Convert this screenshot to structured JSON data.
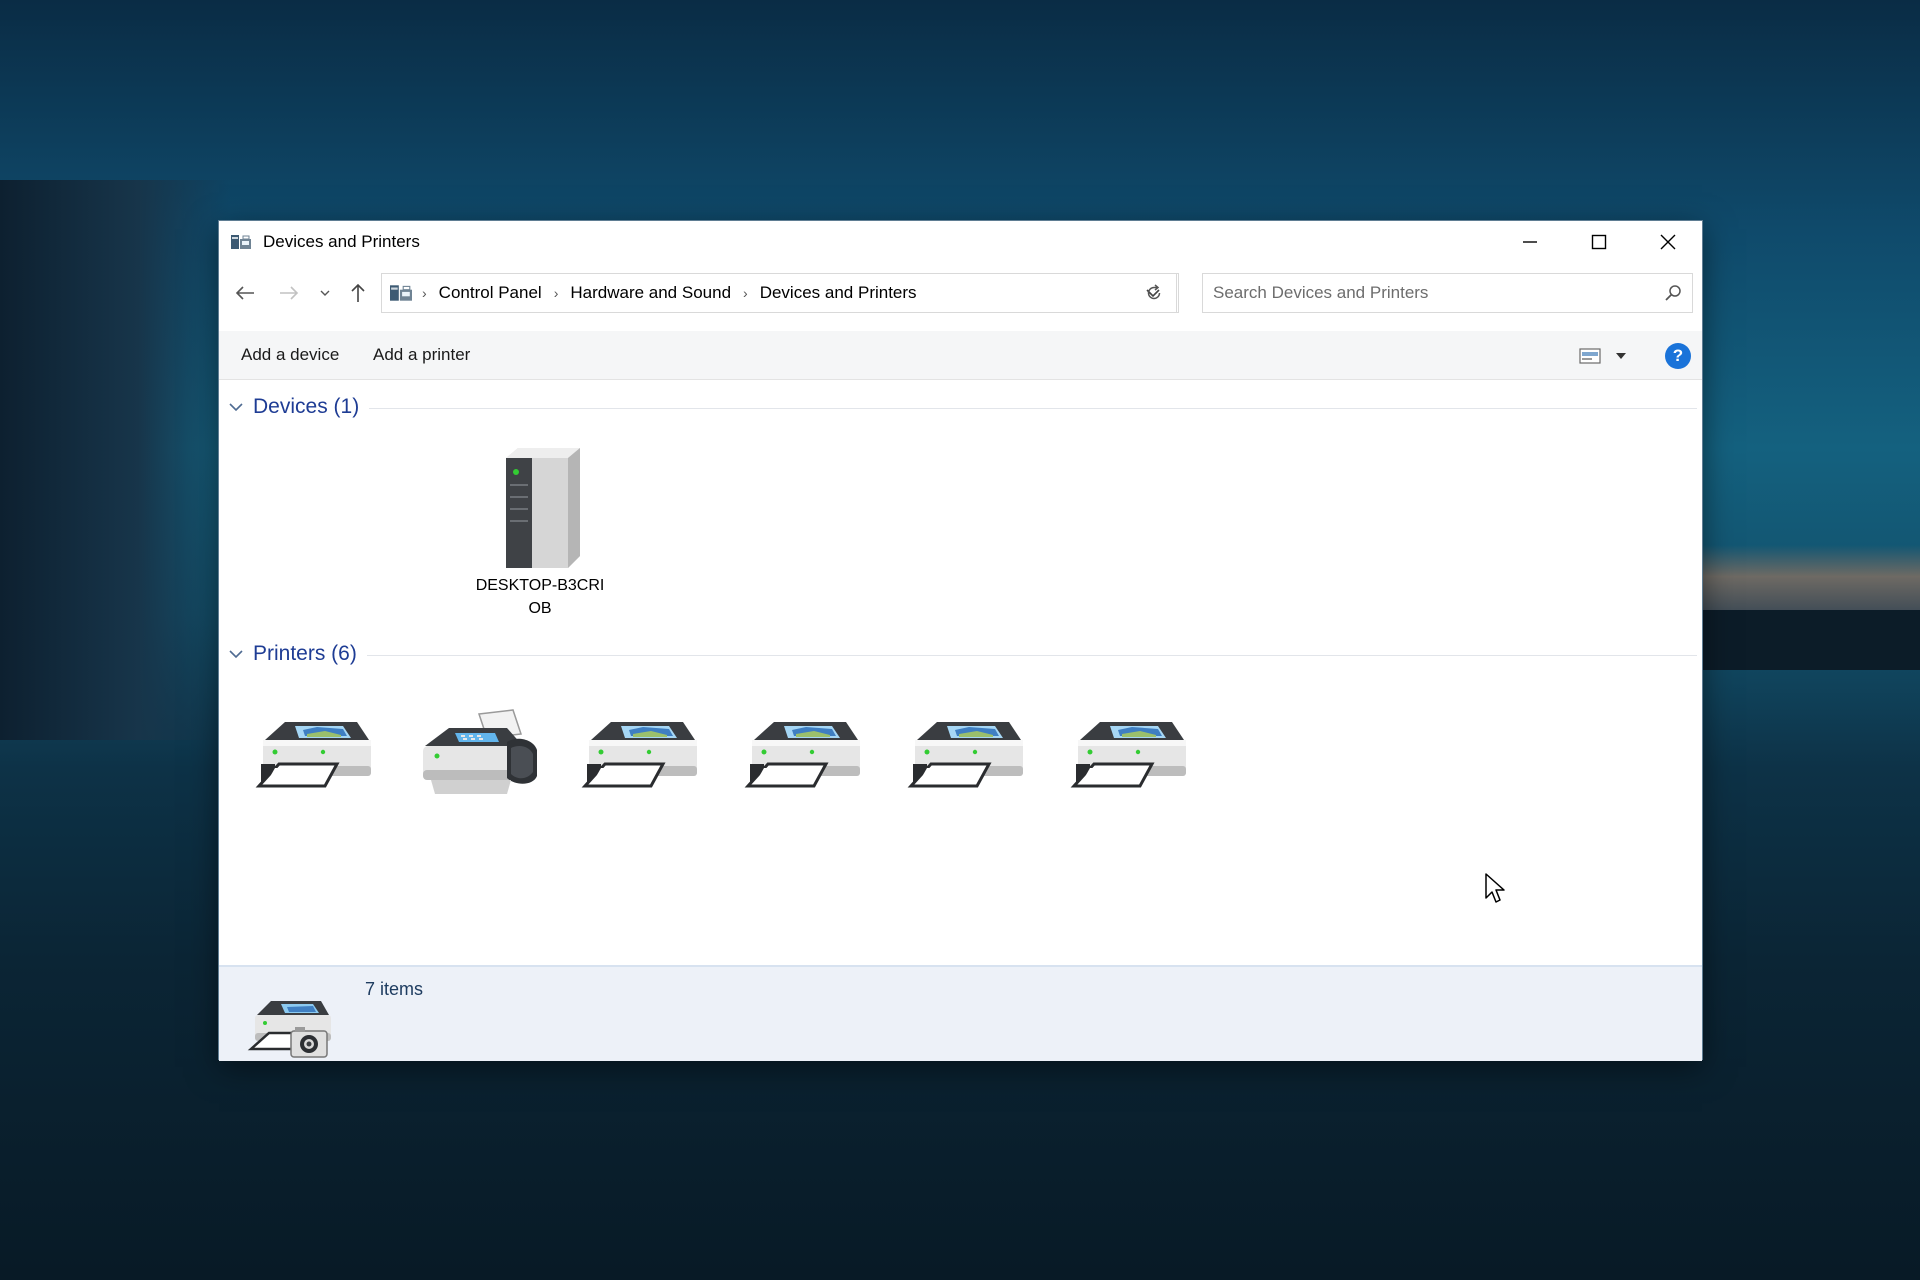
{
  "window": {
    "title": "Devices and Printers"
  },
  "navigation": {
    "breadcrumb": [
      "Control Panel",
      "Hardware and Sound",
      "Devices and Printers"
    ],
    "search_placeholder": "Search Devices and Printers"
  },
  "commands": {
    "add_device": "Add a device",
    "add_printer": "Add a printer",
    "help": "?"
  },
  "groups": {
    "devices": {
      "title": "Devices (1)",
      "items": [
        {
          "label": "DESKTOP-B3CRIOB",
          "icon": "computer-tower-icon"
        }
      ]
    },
    "printers": {
      "title": "Printers (6)",
      "items": [
        {
          "icon": "printer-icon"
        },
        {
          "icon": "fax-icon"
        },
        {
          "icon": "printer-icon"
        },
        {
          "icon": "printer-icon"
        },
        {
          "icon": "printer-icon"
        },
        {
          "icon": "printer-icon"
        }
      ]
    }
  },
  "status": {
    "count": "7 items",
    "icon": "printer-camera-icon"
  },
  "colors": {
    "group_header": "#1e3c94",
    "help_button": "#1a73d9",
    "status_background": "#edf1f8"
  }
}
